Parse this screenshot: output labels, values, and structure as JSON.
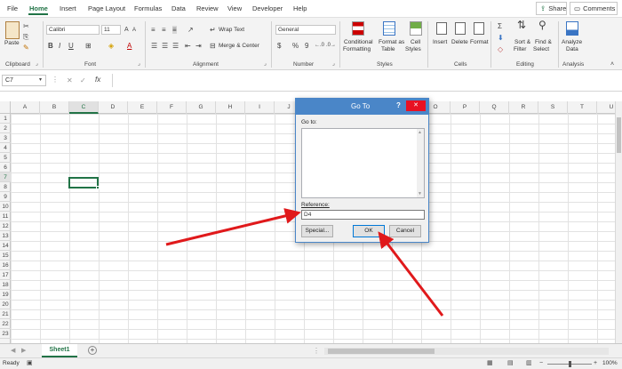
{
  "tabs": [
    "File",
    "Home",
    "Insert",
    "Page Layout",
    "Formulas",
    "Data",
    "Review",
    "View",
    "Developer",
    "Help"
  ],
  "share_label": "Share",
  "comments_label": "Comments",
  "ribbon": {
    "clipboard": {
      "paste": "Paste",
      "label": "Clipboard"
    },
    "font": {
      "name": "Calibri",
      "size": "11",
      "bold": "B",
      "italic": "I",
      "underline": "U",
      "grow": "A",
      "shrink": "A",
      "label": "Font"
    },
    "alignment": {
      "wrap_text": "Wrap Text",
      "merge_center": "Merge & Center",
      "label": "Alignment"
    },
    "number": {
      "format": "General",
      "currency": "$",
      "percent": "%",
      "comma": "9",
      "label": "Number"
    },
    "styles": {
      "conditional_1": "Conditional",
      "conditional_2": "Formatting",
      "format_table_1": "Format as",
      "format_table_2": "Table",
      "cell_styles_1": "Cell",
      "cell_styles_2": "Styles",
      "label": "Styles"
    },
    "cells": {
      "insert": "Insert",
      "delete": "Delete",
      "format": "Format",
      "label": "Cells"
    },
    "editing": {
      "sort_1": "Sort &",
      "sort_2": "Filter",
      "find_1": "Find &",
      "find_2": "Select",
      "label": "Editing"
    },
    "analysis": {
      "analyze_1": "Analyze",
      "analyze_2": "Data",
      "label": "Analysis"
    }
  },
  "formula_bar": {
    "name_box": "C7",
    "fx": "fx",
    "cancel": "✕",
    "enter": "✓",
    "content": ""
  },
  "columns": [
    "A",
    "B",
    "C",
    "D",
    "E",
    "F",
    "G",
    "H",
    "I",
    "J",
    "K",
    "L",
    "M",
    "N",
    "O",
    "P",
    "Q",
    "R",
    "S",
    "T",
    "U"
  ],
  "rows": [
    "1",
    "2",
    "3",
    "4",
    "5",
    "6",
    "7",
    "8",
    "9",
    "10",
    "11",
    "12",
    "13",
    "14",
    "15",
    "16",
    "17",
    "18",
    "19",
    "20",
    "21",
    "22",
    "23"
  ],
  "selected_column": "C",
  "selected_row": "7",
  "sheet_tab": "Sheet1",
  "status": {
    "ready": "Ready",
    "zoom": "100%"
  },
  "dialog": {
    "title": "Go To",
    "help": "?",
    "close": "✕",
    "goto_label": "Go to:",
    "reference_label": "Reference:",
    "reference_value": "D4",
    "special": "Special...",
    "ok": "OK",
    "cancel": "Cancel"
  },
  "colors": {
    "accent": "#217346",
    "dialog_title": "#4a86c8",
    "arrow": "#e0191b"
  }
}
